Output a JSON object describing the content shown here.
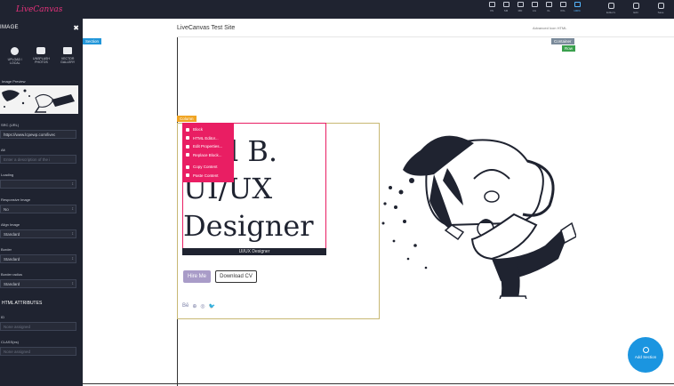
{
  "app": {
    "logo": "LiveCanvas",
    "devices": [
      {
        "label": "XS",
        "active": false
      },
      {
        "label": "SM",
        "active": false
      },
      {
        "label": "MD",
        "active": false
      },
      {
        "label": "LG",
        "active": false
      },
      {
        "label": "XL",
        "active": false
      },
      {
        "label": "XXL",
        "active": false
      },
      {
        "label": "100%",
        "active": true
      }
    ],
    "tools": [
      {
        "label": "Editor's",
        "icon": "editor-icon"
      },
      {
        "label": "Edit",
        "icon": "edit-icon"
      },
      {
        "label": "Save",
        "icon": "save-icon"
      }
    ]
  },
  "sidebar": {
    "title": "IMAGE",
    "sources": [
      {
        "label": "UPLOAD / LOCAL",
        "icon": "wordpress-icon"
      },
      {
        "label": "UNSPLASH PHOTOS",
        "icon": "camera-icon"
      },
      {
        "label": "VECTOR GALLERY",
        "icon": "image-icon"
      }
    ],
    "preview_label": "Image Preview",
    "fields": {
      "src_label": "SRC (URL)",
      "src_value": "https://www.lcpewp.com/livec",
      "alt_label": "Alt",
      "alt_placeholder": "Enter a description of the i",
      "loading_label": "Loading",
      "loading_value": "",
      "responsive_label": "Responsive Image",
      "responsive_value": "No",
      "align_label": "Align Image",
      "align_value": "Standard",
      "border_label": "Border",
      "border_value": "Standard",
      "radius_label": "Border radius",
      "radius_value": "Standard"
    },
    "html_section": "HTML ATTRIBUTES",
    "id_label": "ID",
    "id_placeholder": "None assigned",
    "class_label": "CLASS(es)",
    "class_placeholder": "None assigned"
  },
  "canvas": {
    "site_title": "LiveCanvas Test Site",
    "nav_item": "Advanced Icon HTML",
    "badges": {
      "section": "Section",
      "container": "Container",
      "row": "Row",
      "column": "Column"
    },
    "heading_line1": "l B.",
    "heading_line2": "UI/UX",
    "heading_line3": "Designer",
    "subtitle": "UI/UX Designer",
    "context_menu": {
      "title": "Block",
      "items": [
        "HTML Editor...",
        "Edit Properties...",
        "Replace Block...",
        "Copy Content",
        "Paste Content"
      ]
    },
    "btn_hire": "Hire Me",
    "btn_cv": "Download CV",
    "social": [
      "Bē",
      "⊕",
      "◎",
      "🐦"
    ],
    "add_section": "Add Section"
  }
}
